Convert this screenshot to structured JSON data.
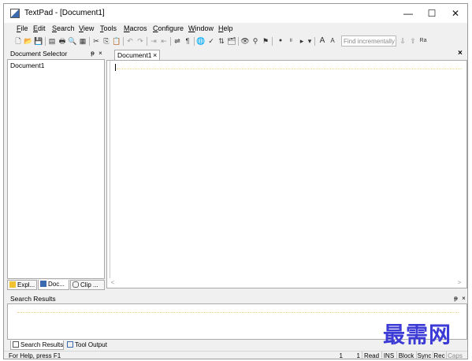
{
  "window": {
    "title": "TextPad - [Document1]"
  },
  "window_controls": {
    "minimize": "—",
    "maximize": "☐",
    "close": "✕"
  },
  "menu": [
    {
      "prefix": "",
      "ul": "F",
      "rest": "ile"
    },
    {
      "prefix": "",
      "ul": "E",
      "rest": "dit"
    },
    {
      "prefix": "",
      "ul": "S",
      "rest": "earch"
    },
    {
      "prefix": "",
      "ul": "V",
      "rest": "iew"
    },
    {
      "prefix": "",
      "ul": "T",
      "rest": "ools"
    },
    {
      "prefix": "",
      "ul": "M",
      "rest": "acros"
    },
    {
      "prefix": "",
      "ul": "C",
      "rest": "onfigure"
    },
    {
      "prefix": "",
      "ul": "W",
      "rest": "indow"
    },
    {
      "prefix": "",
      "ul": "H",
      "rest": "elp"
    }
  ],
  "toolbar": {
    "find_placeholder": "Find incrementally",
    "font_increase": "A",
    "font_decrease": "A",
    "record_glyph": "●"
  },
  "document_selector": {
    "title": "Document Selector",
    "pin": "ᵽ",
    "close": "×",
    "items": [
      "Document1"
    ],
    "tabs": [
      "Expl...",
      "Doc...",
      "Clip ..."
    ]
  },
  "editor": {
    "tabs": [
      {
        "label": "Document1",
        "close": "×"
      }
    ],
    "panel_close": "×"
  },
  "search_results": {
    "title": "Search Results",
    "pin": "ᵽ",
    "close": "×",
    "tabs": [
      "Search Results",
      "Tool Output"
    ]
  },
  "status": {
    "help": "For Help, press F1",
    "line": "1",
    "col": "1",
    "read": "Read",
    "ins": "INS",
    "block": "Block",
    "sync": "Sync",
    "rec": "Rec",
    "caps": "Caps"
  },
  "watermark": "最需网",
  "colors": {
    "accent": "#3b6ab0",
    "watermark": "#3d3bd6"
  }
}
